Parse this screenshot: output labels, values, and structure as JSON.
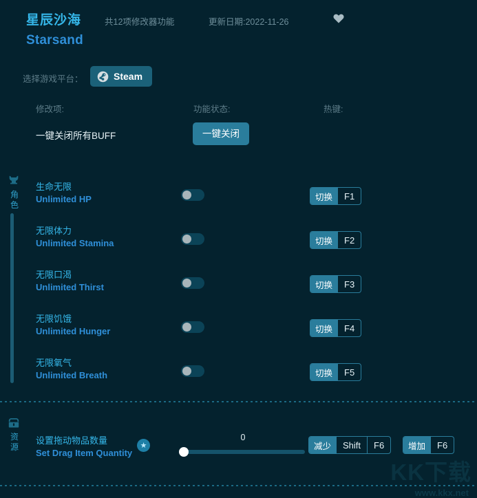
{
  "header": {
    "title_cn": "星辰沙海",
    "title_en": "Starsand",
    "feature_count": "共12项修改器功能",
    "update_date": "更新日期:2022-11-26",
    "favorite_icon": "heart-icon"
  },
  "platform": {
    "label": "选择游戏平台：",
    "selected": "Steam",
    "icon": "steam-icon"
  },
  "columns": {
    "modifier": "修改项:",
    "status": "功能状态:",
    "hotkey": "热键:"
  },
  "global": {
    "label": "一键关闭所有BUFF",
    "button": "一键关闭"
  },
  "sections": [
    {
      "id": "character",
      "side_label": "角色",
      "side_icon": "helmet-icon",
      "rows": [
        {
          "name_cn": "生命无限",
          "name_en": "Unlimited HP",
          "toggle": "off",
          "hk_action": "切换",
          "hk_key": "F1"
        },
        {
          "name_cn": "无限体力",
          "name_en": "Unlimited Stamina",
          "toggle": "off",
          "hk_action": "切换",
          "hk_key": "F2"
        },
        {
          "name_cn": "无限口渴",
          "name_en": "Unlimited Thirst",
          "toggle": "off",
          "hk_action": "切换",
          "hk_key": "F3"
        },
        {
          "name_cn": "无限饥饿",
          "name_en": "Unlimited Hunger",
          "toggle": "off",
          "hk_action": "切换",
          "hk_key": "F4"
        },
        {
          "name_cn": "无限氧气",
          "name_en": "Unlimited Breath",
          "toggle": "off",
          "hk_action": "切换",
          "hk_key": "F5"
        }
      ]
    },
    {
      "id": "resource",
      "side_label": "资源",
      "side_icon": "chest-icon",
      "slider_row": {
        "name_cn": "设置拖动物品数量",
        "name_en": "Set Drag Item Quantity",
        "badge_icon": "star-icon",
        "value": "0",
        "decrease_action": "减少",
        "decrease_mod": "Shift",
        "decrease_key": "F6",
        "increase_action": "增加",
        "increase_key": "F6"
      }
    }
  ],
  "watermark": {
    "brand": "KK下载",
    "url": "www.kkx.net"
  },
  "colors": {
    "background": "#04222e",
    "accent_cyan": "#35b6e8",
    "accent_blue": "#2f8fd8",
    "button_teal": "#2a7d9c",
    "muted": "#5d7c88"
  }
}
